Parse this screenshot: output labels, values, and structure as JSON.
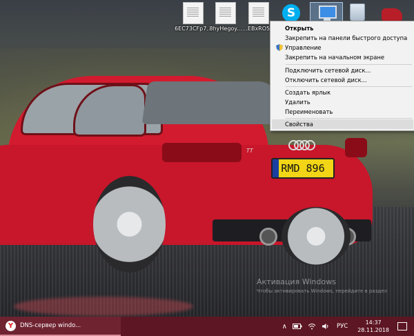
{
  "desktop": {
    "icons": [
      {
        "label": "6EC73CFp7...",
        "type": "document"
      },
      {
        "label": "8hyHegoy...",
        "type": "document"
      },
      {
        "label": "...EBxRO5...",
        "type": "document"
      },
      {
        "label": "",
        "type": "skype"
      },
      {
        "label": "",
        "type": "this-pc"
      },
      {
        "label": "",
        "type": "recycle-bin"
      },
      {
        "label": "",
        "type": "car-image"
      }
    ],
    "car_plate": "RMD 896",
    "car_badge": "TT"
  },
  "context_menu": {
    "items": {
      "open": "Открыть",
      "pin_quick_access": "Закрепить на панели быстрого доступа",
      "manage": "Управление",
      "pin_start": "Закрепить на начальном экране",
      "map_drive": "Подключить сетевой диск...",
      "disconnect_drive": "Отключить сетевой диск...",
      "create_shortcut": "Создать ярлык",
      "delete": "Удалить",
      "rename": "Переименовать",
      "properties": "Свойства"
    },
    "highlighted": "properties"
  },
  "watermark": {
    "line1": "Активация Windows",
    "line2": "Чтобы активировать Windows, перейдите в раздел"
  },
  "taskbar": {
    "active_app_label": "DNS-сервер windo...",
    "language": "РУС",
    "time": "14:37",
    "date": "28.11.2018",
    "accent_color": "#5d1623"
  }
}
